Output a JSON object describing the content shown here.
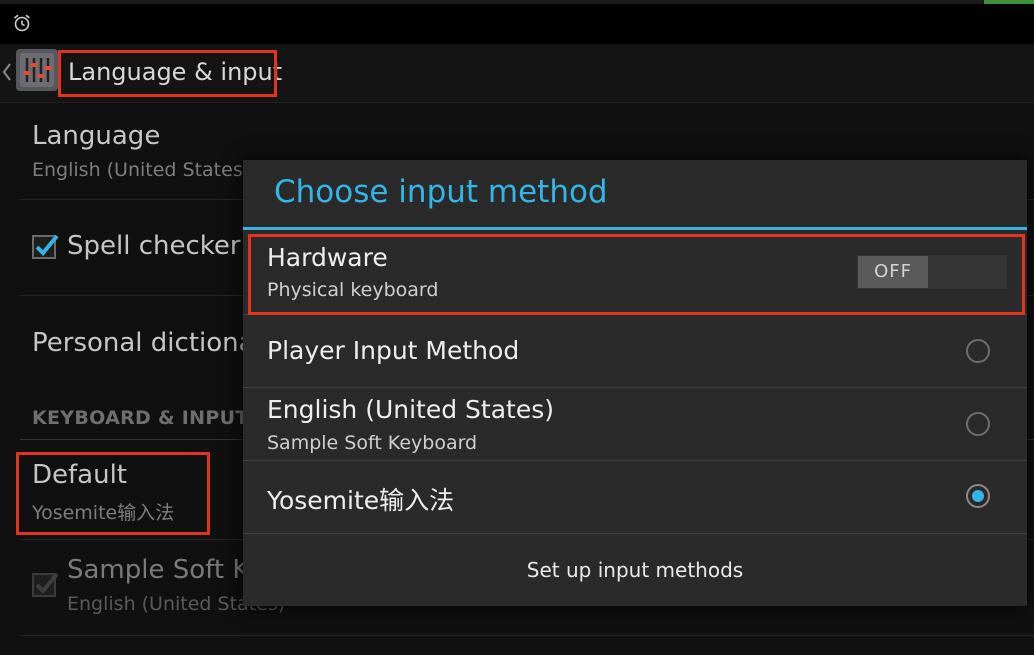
{
  "status_bar": {
    "icons": [
      "alarm-icon"
    ]
  },
  "action_bar": {
    "title": "Language & input",
    "app_icon": "settings-sliders-icon"
  },
  "background_settings": {
    "language": {
      "title": "Language",
      "summary": "English (United States)"
    },
    "spell_checker": {
      "title": "Spell checker",
      "checked": true
    },
    "personal_dictionary": {
      "title": "Personal dictiona"
    },
    "section_header": "KEYBOARD & INPUT M",
    "default": {
      "title": "Default",
      "summary": "Yosemite输入法"
    },
    "sample_soft_keyboard": {
      "title": "Sample Soft K",
      "summary": "English (United States)",
      "checked": true
    }
  },
  "dialog": {
    "title": "Choose input method",
    "hardware": {
      "title": "Hardware",
      "summary": "Physical keyboard",
      "switch_label": "OFF",
      "switch_on": false
    },
    "options": [
      {
        "title": "Player Input Method",
        "summary": "",
        "selected": false
      },
      {
        "title": "English (United States)",
        "summary": "Sample Soft Keyboard",
        "selected": false
      },
      {
        "title": "Yosemite输入法",
        "summary": "",
        "selected": true
      }
    ],
    "setup_button": "Set up input methods"
  },
  "colors": {
    "accent": "#33b5e5",
    "highlight": "#e2341d",
    "dialog_bg": "#2a2a2b"
  }
}
